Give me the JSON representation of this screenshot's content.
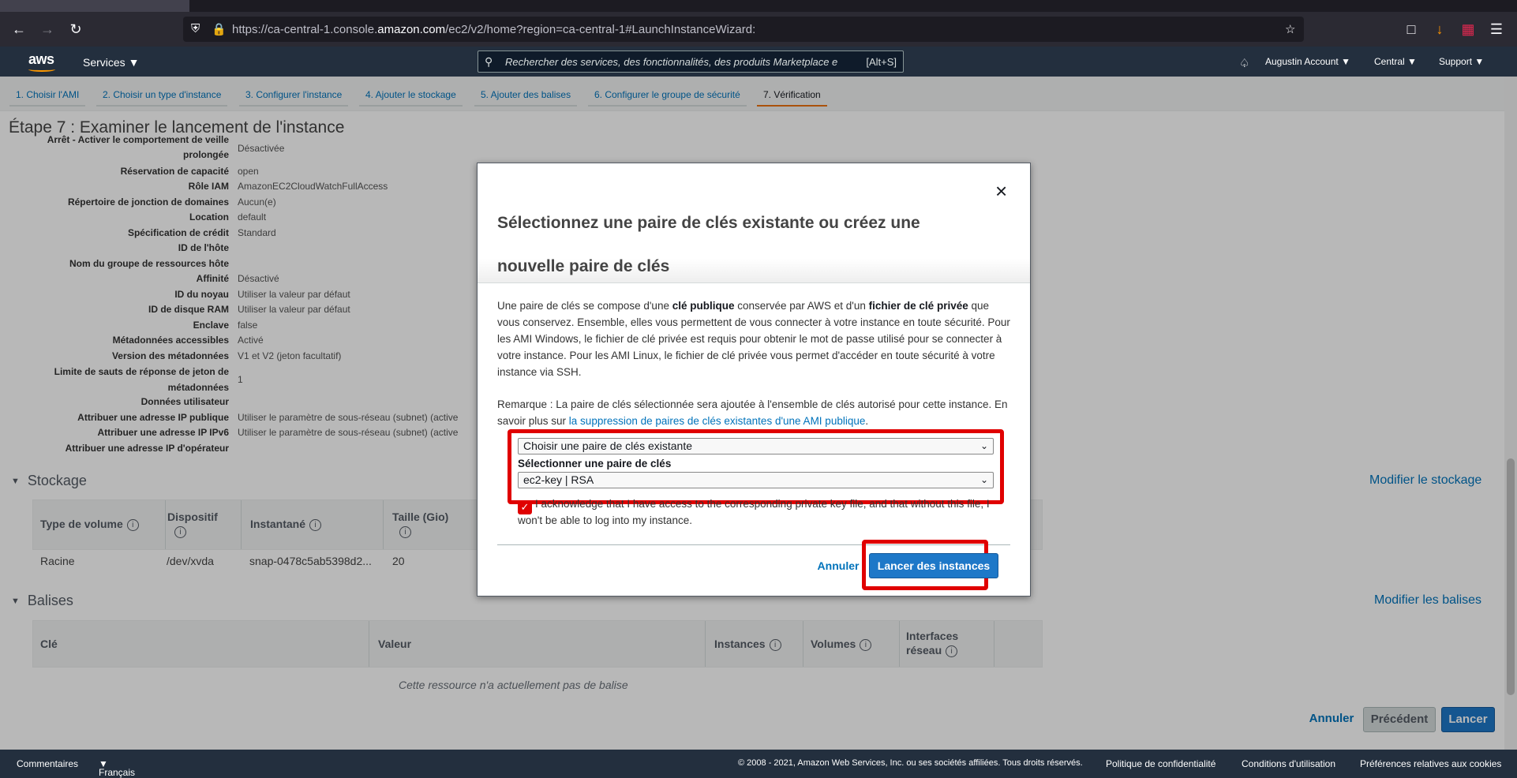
{
  "browser": {
    "url_prefix": "https://ca-central-1.console.",
    "url_domain": "amazon.com",
    "url_suffix": "/ec2/v2/home?region=ca-central-1#LaunchInstanceWizard:"
  },
  "aws_header": {
    "logo": "aws",
    "services": "Services",
    "search_placeholder": "Rechercher des services, des fonctionnalités, des produits Marketplace e",
    "search_shortcut": "[Alt+S]",
    "account": "Augustin Account",
    "region": "Central",
    "support": "Support"
  },
  "wizard_steps": [
    "1. Choisir l'AMI",
    "2. Choisir un type d'instance",
    "3. Configurer l'instance",
    "4. Ajouter le stockage",
    "5. Ajouter des balises",
    "6. Configurer le groupe de sécurité",
    "7. Vérification"
  ],
  "page_title": "Étape 7 : Examiner le lancement de l'instance",
  "details": [
    {
      "label": "Arrêt - Activer le comportement de veille prolongée",
      "value": "Désactivée"
    },
    {
      "label": "Réservation de capacité",
      "value": "open"
    },
    {
      "label": "Rôle IAM",
      "value": "AmazonEC2CloudWatchFullAccess"
    },
    {
      "label": "Répertoire de jonction de domaines",
      "value": "Aucun(e)"
    },
    {
      "label": "Location",
      "value": "default"
    },
    {
      "label": "Spécification de crédit",
      "value": "Standard"
    },
    {
      "label": "ID de l'hôte",
      "value": ""
    },
    {
      "label": "Nom du groupe de ressources hôte",
      "value": ""
    },
    {
      "label": "Affinité",
      "value": "Désactivé"
    },
    {
      "label": "ID du noyau",
      "value": "Utiliser la valeur par défaut"
    },
    {
      "label": "ID de disque RAM",
      "value": "Utiliser la valeur par défaut"
    },
    {
      "label": "Enclave",
      "value": "false"
    },
    {
      "label": "Métadonnées accessibles",
      "value": "Activé"
    },
    {
      "label": "Version des métadonnées",
      "value": "V1 et V2 (jeton facultatif)"
    },
    {
      "label": "Limite de sauts de réponse de jeton de métadonnées",
      "value": "1"
    },
    {
      "label": "Données utilisateur",
      "value": ""
    },
    {
      "label": "Attribuer une adresse IP publique",
      "value": "Utiliser le paramètre de sous-réseau (subnet) (active"
    },
    {
      "label": "Attribuer une adresse IP IPv6",
      "value": "Utiliser le paramètre de sous-réseau (subnet) (active"
    },
    {
      "label": "Attribuer une adresse IP d'opérateur",
      "value": ""
    }
  ],
  "storage": {
    "heading": "Stockage",
    "edit_link": "Modifier le stockage",
    "columns": [
      "Type de volume",
      "Dispositif",
      "Instantané",
      "Taille (Gio)"
    ],
    "row": [
      "Racine",
      "/dev/xvda",
      "snap-0478c5ab5398d2...",
      "20"
    ]
  },
  "tags": {
    "heading": "Balises",
    "edit_link": "Modifier les balises",
    "columns": [
      "Clé",
      "Valeur",
      "Instances",
      "Volumes",
      "Interfaces réseau"
    ],
    "empty": "Cette ressource n'a actuellement pas de balise"
  },
  "page_buttons": {
    "cancel": "Annuler",
    "previous": "Précédent",
    "launch": "Lancer"
  },
  "modal": {
    "title": "Sélectionnez une paire de clés existante ou créez une nouvelle paire de clés",
    "close": "×",
    "p1_a": "Une paire de clés se compose d'une ",
    "p1_b": "clé publique",
    "p1_c": " conservée par AWS et d'un ",
    "p1_d": "fichier de clé privée",
    "p1_e": " que vous conservez. Ensemble, elles vous permettent de vous connecter à votre instance en toute sécurité. Pour les AMI Windows, le fichier de clé privée est requis pour obtenir le mot de passe utilisé pour se connecter à votre instance. Pour les AMI Linux, le fichier de clé privée vous permet d'accéder en toute sécurité à votre instance via SSH.",
    "p2_a": "Remarque : La paire de clés sélectionnée sera ajoutée à l'ensemble de clés autorisé pour cette instance. En savoir plus sur ",
    "p2_link": "la suppression de paires de clés existantes d'une AMI publique",
    "p2_end": ".",
    "select1_value": "Choisir une paire de clés existante",
    "select2_label": "Sélectionner une paire de clés",
    "select2_value": "ec2-key | RSA",
    "ack_text": "I acknowledge that I have access to the corresponding private key file, and that without this file, I won't be able to log into my instance.",
    "ack_checked": true,
    "cancel": "Annuler",
    "launch": "Lancer des instances"
  },
  "footer": {
    "feedback": "Commentaires",
    "language": "Français",
    "copyright": "© 2008 - 2021, Amazon Web Services, Inc. ou ses sociétés affiliées. Tous droits réservés.",
    "privacy": "Politique de confidentialité",
    "terms": "Conditions d'utilisation",
    "cookies": "Préférences relatives aux cookies"
  },
  "colors": {
    "aws_navy": "#232f3e",
    "link_blue": "#0073bb",
    "primary_blue": "#1e78c8",
    "highlight_red": "#e00000",
    "active_step": "#ec7211"
  }
}
